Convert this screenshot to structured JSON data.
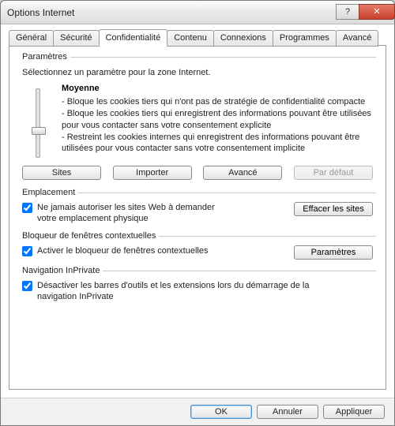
{
  "window": {
    "title": "Options Internet"
  },
  "tabs": {
    "general": "Général",
    "security": "Sécurité",
    "privacy": "Confidentialité",
    "content": "Contenu",
    "connections": "Connexions",
    "programs": "Programmes",
    "advanced": "Avancé"
  },
  "params": {
    "legend": "Paramètres",
    "intro": "Sélectionnez un paramètre pour la zone Internet.",
    "level": "Moyenne",
    "line1": "- Bloque les cookies tiers qui n'ont pas de stratégie de confidentialité compacte",
    "line2": "- Bloque les cookies tiers qui enregistrent des informations pouvant être utilisées pour vous contacter sans votre consentement explicite",
    "line3": "- Restreint les cookies internes qui enregistrent des informations pouvant être utilisées pour vous contacter sans votre consentement implicite",
    "btn_sites": "Sites",
    "btn_import": "Importer",
    "btn_advanced": "Avancé",
    "btn_default": "Par défaut"
  },
  "location": {
    "legend": "Emplacement",
    "check": "Ne jamais autoriser les sites Web à demander votre emplacement physique",
    "btn_clear": "Effacer les sites"
  },
  "popup": {
    "legend": "Bloqueur de fenêtres contextuelles",
    "check": "Activer le bloqueur de fenêtres contextuelles",
    "btn_settings": "Paramètres"
  },
  "inprivate": {
    "legend": "Navigation InPrivate",
    "check": "Désactiver les barres d'outils et les extensions lors du démarrage de la navigation InPrivate"
  },
  "footer": {
    "ok": "OK",
    "cancel": "Annuler",
    "apply": "Appliquer"
  }
}
